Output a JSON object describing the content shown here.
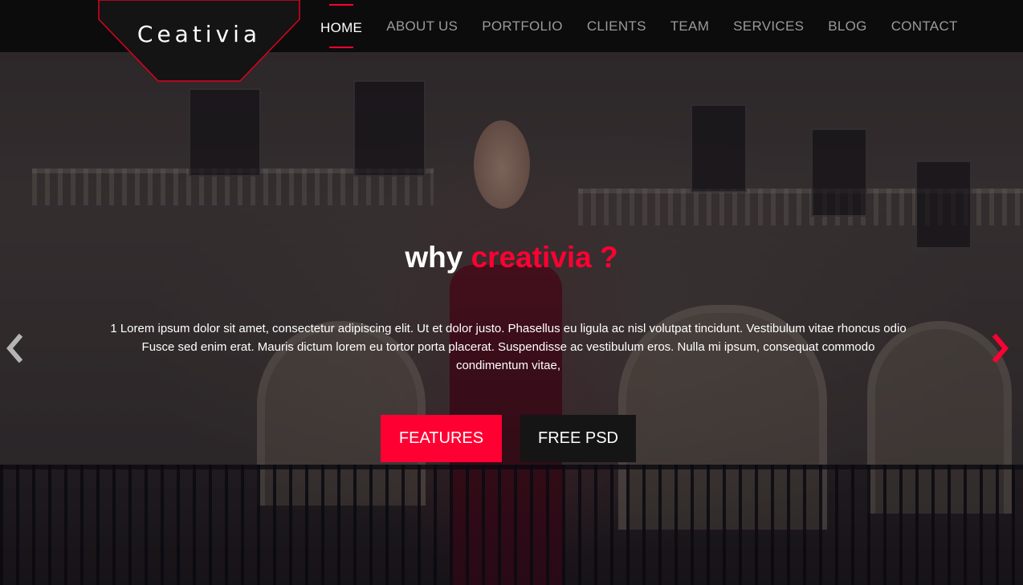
{
  "brand": {
    "name": "Ceativia",
    "accent_color": "#ff0033"
  },
  "nav": {
    "items": [
      {
        "label": "HOME",
        "active": true
      },
      {
        "label": "ABOUT US",
        "active": false
      },
      {
        "label": "PORTFOLIO",
        "active": false
      },
      {
        "label": "CLIENTS",
        "active": false
      },
      {
        "label": "TEAM",
        "active": false
      },
      {
        "label": "SERVICES",
        "active": false
      },
      {
        "label": "BLOG",
        "active": false
      },
      {
        "label": "CONTACT",
        "active": false
      }
    ]
  },
  "hero": {
    "headline_plain": "why ",
    "headline_accent": "creativia ?",
    "description": "1 Lorem ipsum dolor sit amet, consectetur adipiscing elit. Ut et dolor justo. Phasellus eu ligula ac nisl volutpat tincidunt. Vestibulum vitae rhoncus odio Fusce sed enim erat. Mauris dictum lorem eu tortor porta placerat. Suspendisse ac vestibulum eros. Nulla mi ipsum, consequat commodo condimentum vitae,",
    "buttons": {
      "features_label": "FEATURES",
      "free_psd_label": "FREE PSD"
    },
    "prev_icon": "chevron-left-icon",
    "next_icon": "chevron-right-icon"
  }
}
